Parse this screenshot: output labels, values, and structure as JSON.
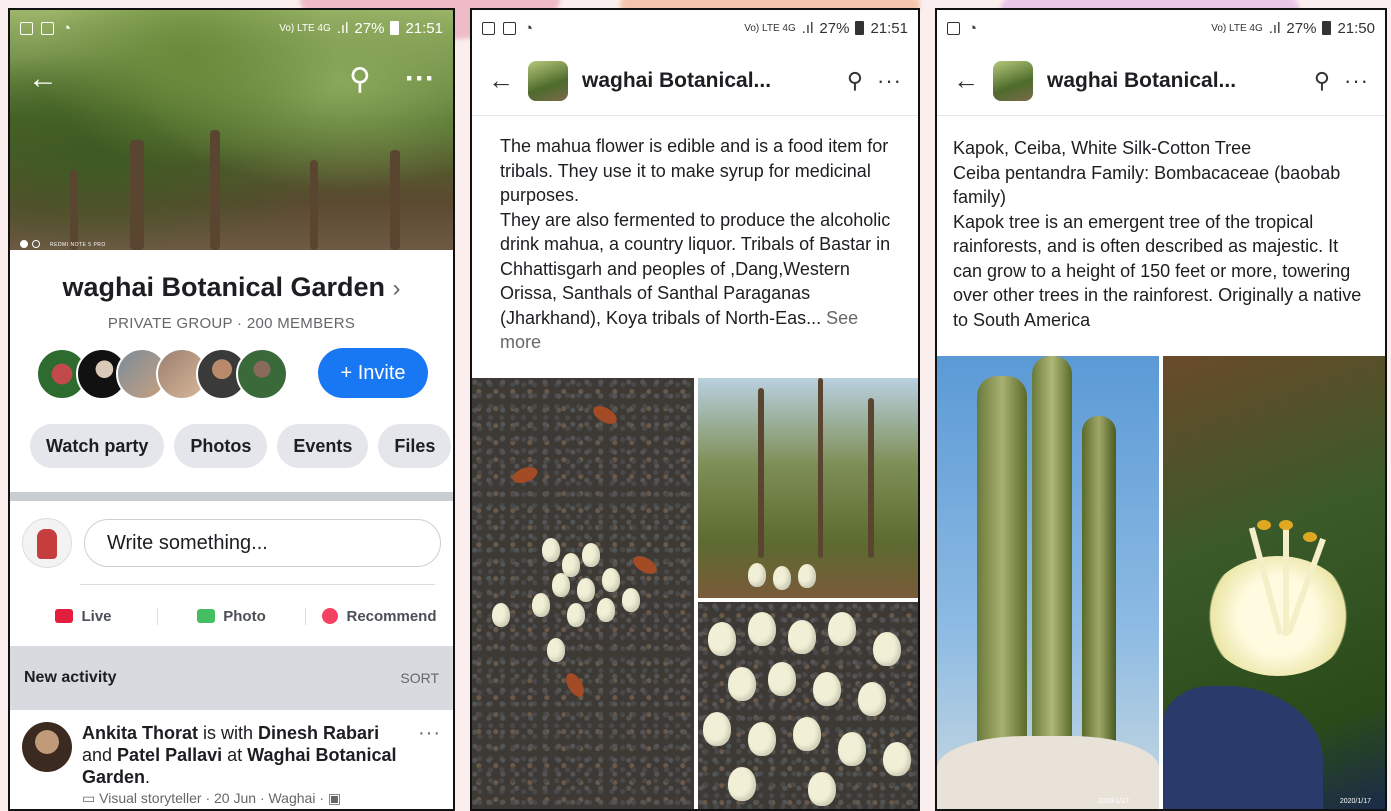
{
  "screen1": {
    "status": {
      "signal": "Vo) LTE 4G",
      "battery": "27%",
      "time": "21:51"
    },
    "group_name": "waghai Botanical Garden",
    "group_sub": "PRIVATE GROUP · 200 MEMBERS",
    "invite_label": "+ Invite",
    "chips": [
      "Watch party",
      "Photos",
      "Events",
      "Files"
    ],
    "composer_placeholder": "Write something...",
    "actions": {
      "live": "Live",
      "photo": "Photo",
      "recommend": "Recommend"
    },
    "activity": {
      "title": "New activity",
      "sort": "SORT"
    },
    "post": {
      "author": "Ankita Thorat",
      "with": " is with ",
      "tag1": "Dinesh Rabari",
      "and": " and ",
      "tag2": "Patel Pallavi",
      "at": " at ",
      "place": "Waghai Botanical Garden",
      "dot": ".",
      "meta": "Visual storyteller · 20 Jun · Waghai ·"
    },
    "cover_watermark": "REDMI NOTE 5 PRO",
    "colors": {
      "accent": "#1877f2",
      "live": "#e41e3f",
      "photo": "#45bd62",
      "recommend": "#f3425f"
    }
  },
  "screen2": {
    "status": {
      "signal": "Vo) LTE 4G",
      "battery": "27%",
      "time": "21:51"
    },
    "title": "waghai Botanical...",
    "text": "The mahua flower is edible and is a food item for tribals. They use it to make syrup for medicinal purposes.\nThey are also fermented to produce the alcoholic drink mahua, a country liquor. Tribals of Bastar in Chhattisgarh and peoples of ,Dang,Western Orissa, Santhals of Santhal Paraganas (Jharkhand), Koya tribals of North-Eas...",
    "see_more": " See more"
  },
  "screen3": {
    "status": {
      "signal": "Vo) LTE 4G",
      "battery": "27%",
      "time": "21:50"
    },
    "title": "waghai Botanical...",
    "text": "Kapok, Ceiba, White Silk-Cotton Tree\nCeiba pentandra    Family: Bombacaceae (baobab family)\nKapok tree is an emergent tree of the tropical rainforests, and is often described as majestic. It can grow to a height of 150 feet or more, towering over other trees in the rainforest. Originally a native to South America",
    "stamp_left": "2020/1/17",
    "stamp_right": "2020/1/17"
  }
}
